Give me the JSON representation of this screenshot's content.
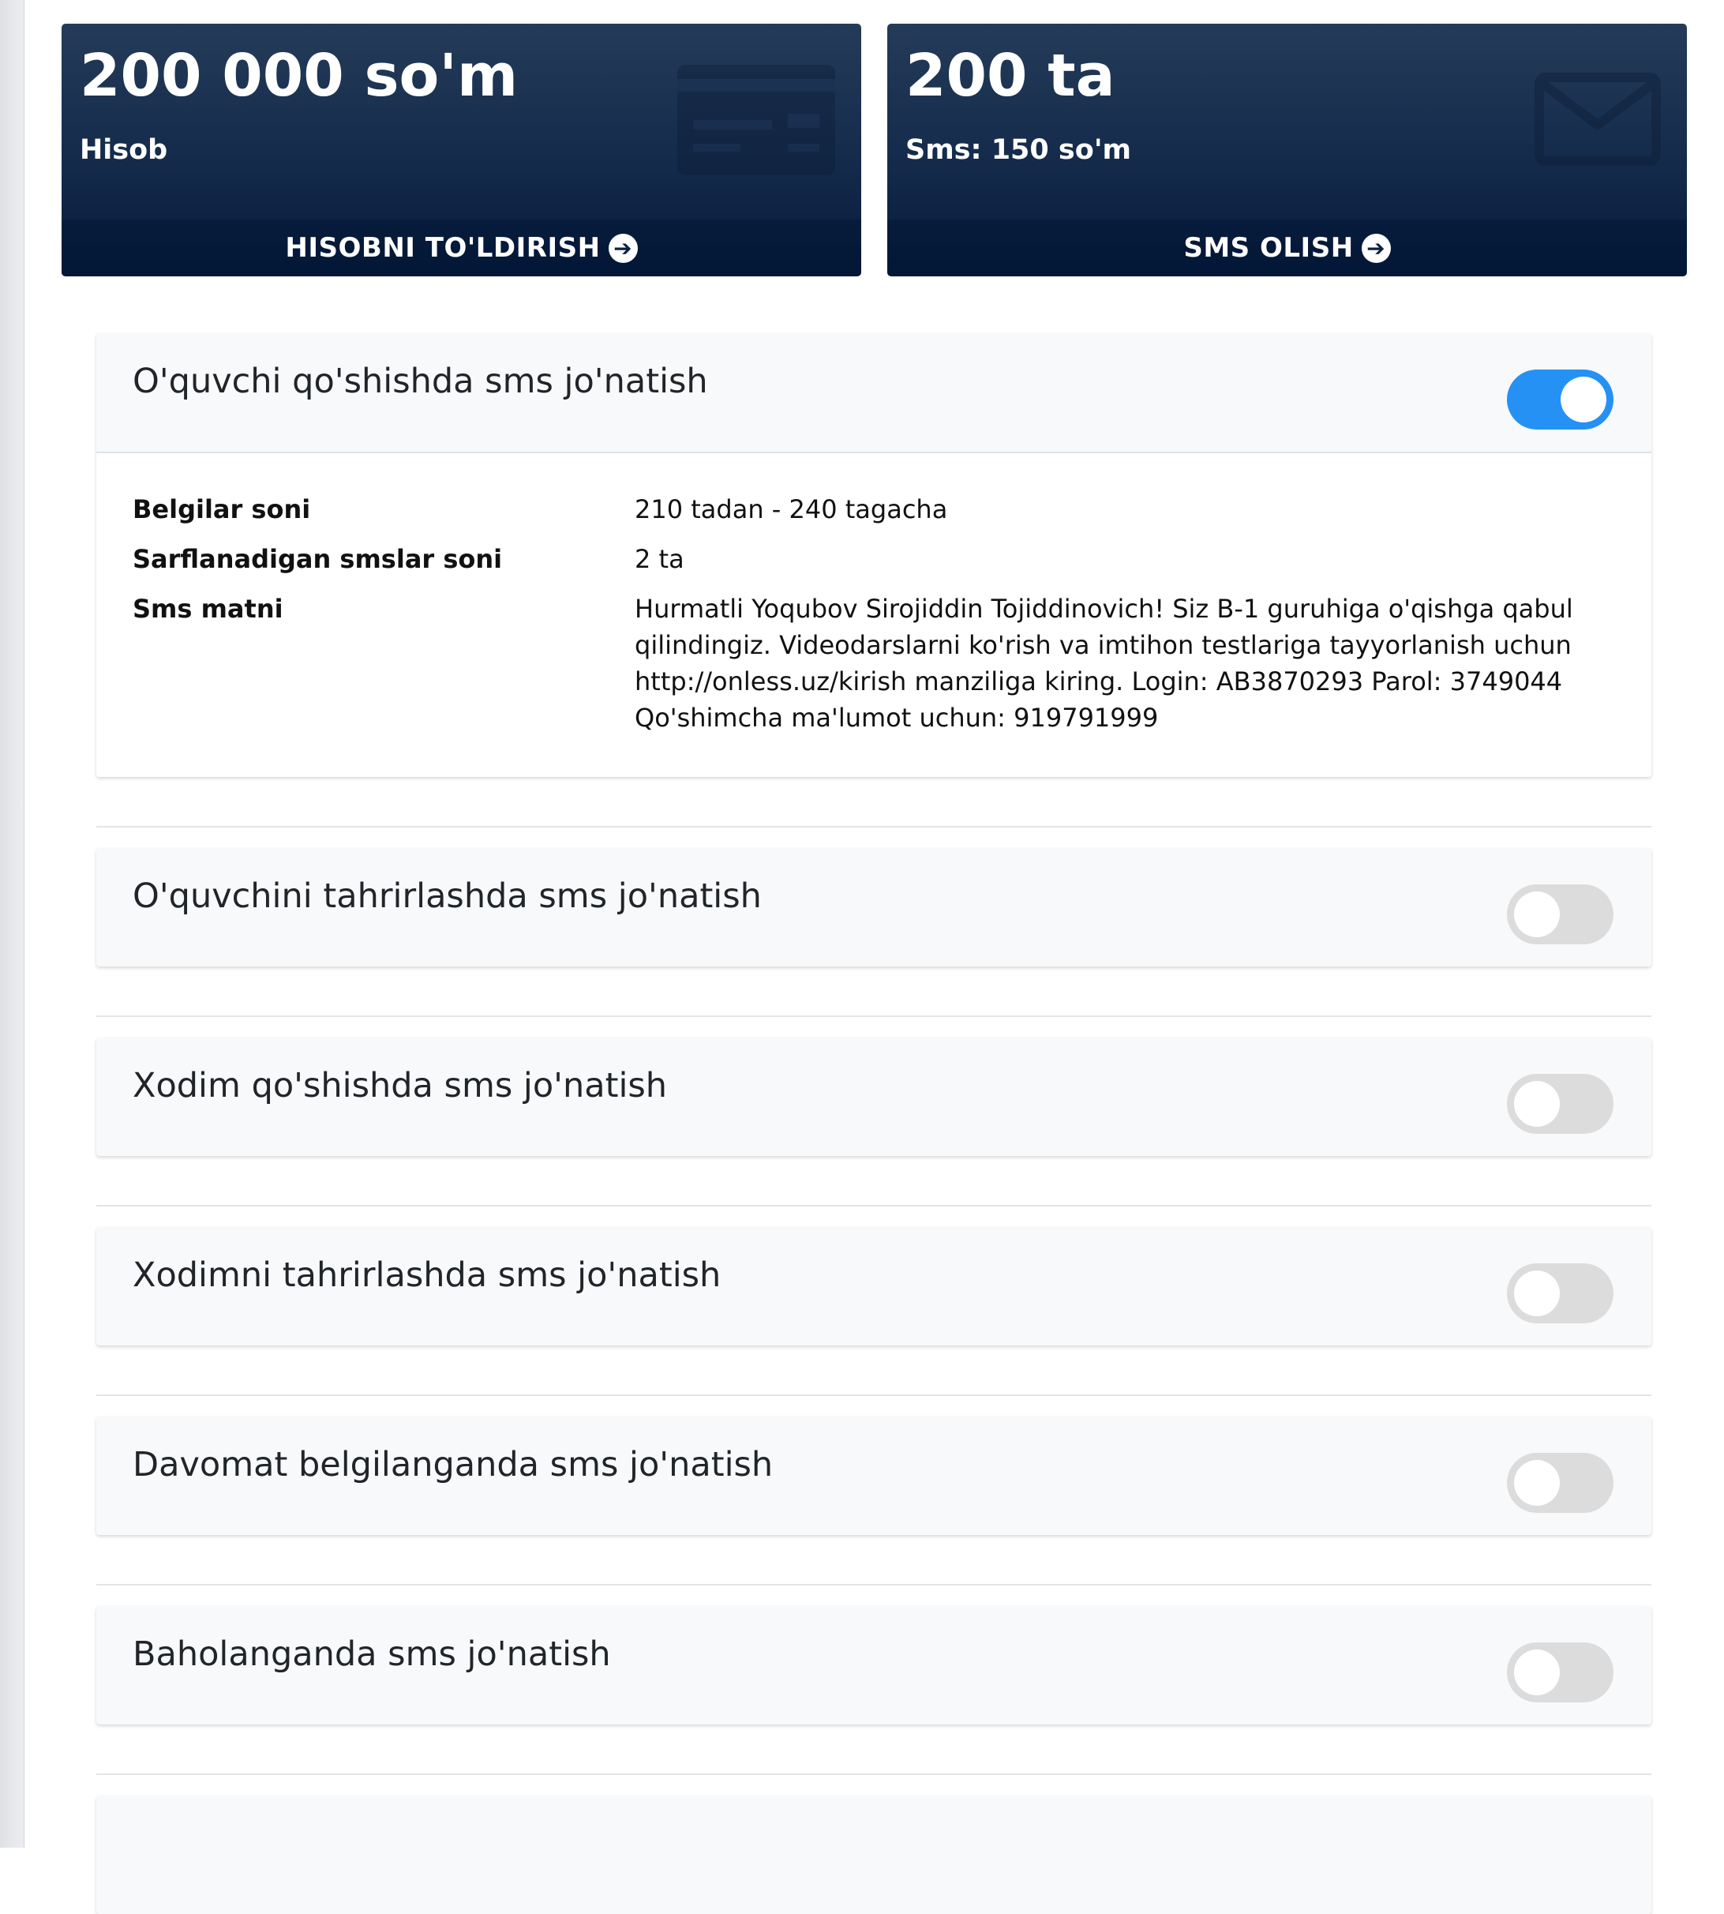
{
  "balance_card": {
    "value": "200 000 so'm",
    "label": "Hisob",
    "action_label": "HISOBNI TO'LDIRISH",
    "icon": "credit-card-icon"
  },
  "sms_card": {
    "value": "200 ta",
    "label": "Sms: 150 so'm",
    "action_label": "SMS OLISH",
    "icon": "envelope-icon"
  },
  "colors": {
    "card_top": "#243b59",
    "card_bottom": "#06193a",
    "toggle_on": "#2591f4",
    "toggle_off": "#dcdcdc"
  },
  "settings": [
    {
      "title": "O'quvchi qo'shishda sms jo'natish",
      "enabled": true,
      "details": [
        {
          "key": "Belgilar soni",
          "value": "210 tadan - 240 tagacha"
        },
        {
          "key": "Sarflanadigan smslar soni",
          "value": "2 ta"
        },
        {
          "key": "Sms matni",
          "value": "Hurmatli Yoqubov Sirojiddin Tojiddinovich! Siz B-1 guruhiga o'qishga qabul qilindingiz. Videodarslarni ko'rish va imtihon testlariga tayyorlanish uchun http://onless.uz/kirish manziliga kiring. Login: AB3870293 Parol: 3749044 Qo'shimcha ma'lumot uchun: 919791999"
        }
      ]
    },
    {
      "title": "O'quvchini tahrirlashda sms jo'natish",
      "enabled": false
    },
    {
      "title": "Xodim qo'shishda sms jo'natish",
      "enabled": false
    },
    {
      "title": "Xodimni tahrirlashda sms jo'natish",
      "enabled": false
    },
    {
      "title": "Davomat belgilanganda sms jo'natish",
      "enabled": false
    },
    {
      "title": "Baholanganda sms jo'natish",
      "enabled": false
    }
  ]
}
